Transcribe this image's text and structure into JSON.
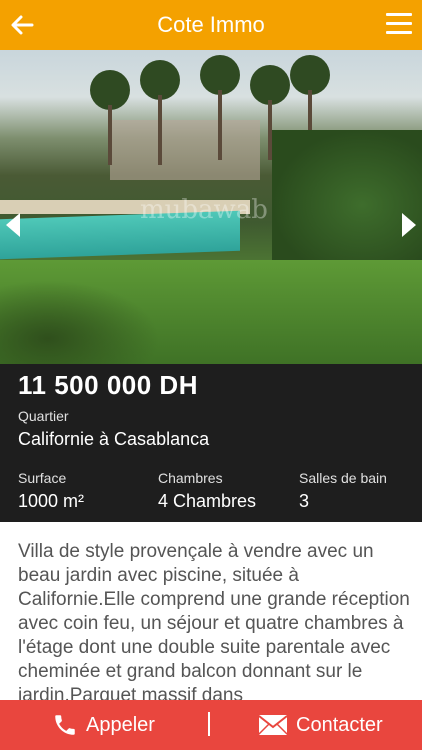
{
  "header": {
    "title": "Cote Immo"
  },
  "listing": {
    "price": "11 500 000 DH",
    "quartier_label": "Quartier",
    "quartier_value": "Californie à Casablanca",
    "surface_label": "Surface",
    "surface_value": "1000 m²",
    "chambres_label": "Chambres",
    "chambres_value": "4 Chambres",
    "bains_label": "Salles de bain",
    "bains_value": "3",
    "description": "Villa de style provençale à vendre avec un beau jardin avec piscine, située à Californie.Elle comprend une grande réception avec coin feu, un séjour et quatre chambres à l'étage dont une double suite parentale avec cheminée et grand balcon donnant sur le jardin.Parquet massif dans"
  },
  "photo": {
    "watermark": "mubawab"
  },
  "actions": {
    "call_label": "Appeler",
    "contact_label": "Contacter"
  },
  "colors": {
    "header": "#f4a100",
    "info_panel": "#1e1e1e",
    "bottom_bar": "#e9463e"
  },
  "icons": [
    "back-arrow-icon",
    "menu-icon",
    "chevron-left-icon",
    "chevron-right-icon",
    "phone-icon",
    "envelope-icon"
  ]
}
